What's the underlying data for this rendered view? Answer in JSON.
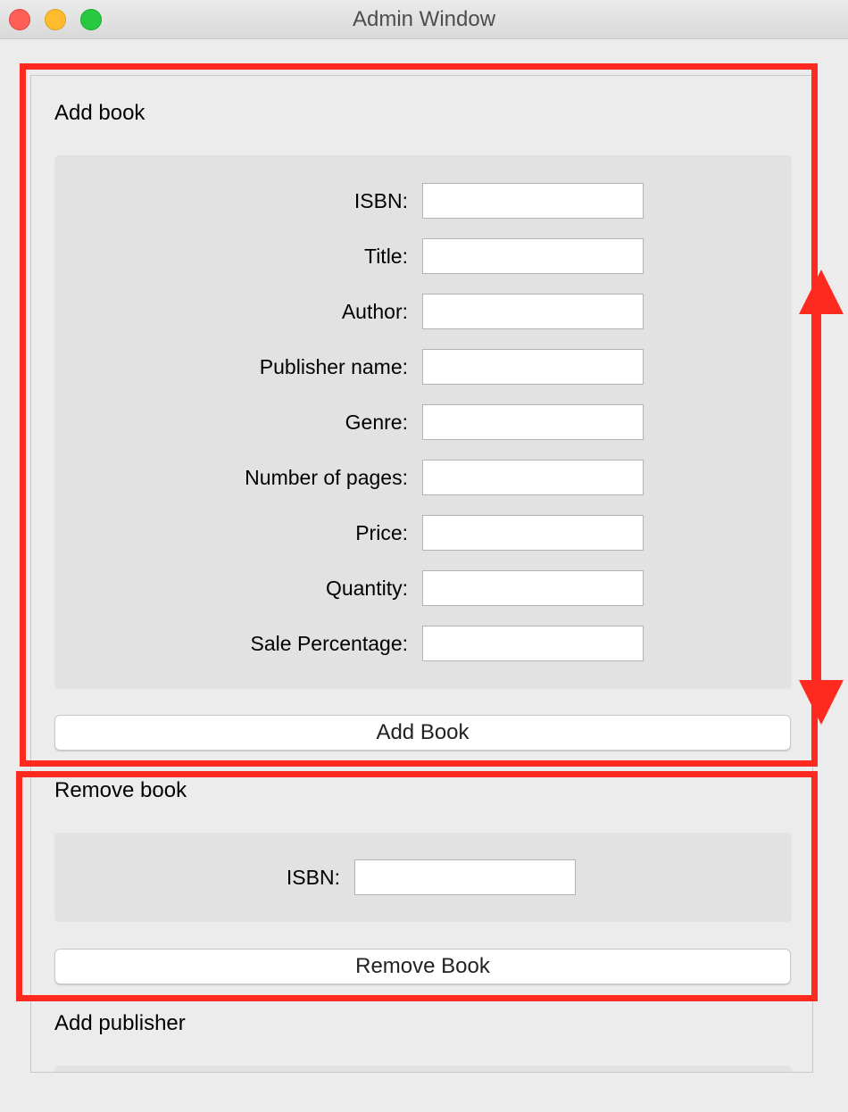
{
  "window": {
    "title": "Admin Window"
  },
  "add_book": {
    "title": "Add book",
    "fields": [
      {
        "label": "ISBN:",
        "value": ""
      },
      {
        "label": "Title:",
        "value": ""
      },
      {
        "label": "Author:",
        "value": ""
      },
      {
        "label": "Publisher name:",
        "value": ""
      },
      {
        "label": "Genre:",
        "value": ""
      },
      {
        "label": "Number of pages:",
        "value": ""
      },
      {
        "label": "Price:",
        "value": ""
      },
      {
        "label": "Quantity:",
        "value": ""
      },
      {
        "label": "Sale Percentage:",
        "value": ""
      }
    ],
    "button_label": "Add Book"
  },
  "remove_book": {
    "title": "Remove book",
    "fields": [
      {
        "label": "ISBN:",
        "value": ""
      }
    ],
    "button_label": "Remove Book"
  },
  "add_publisher": {
    "title": "Add publisher"
  },
  "annotation": {
    "color": "#ff2a1f"
  }
}
